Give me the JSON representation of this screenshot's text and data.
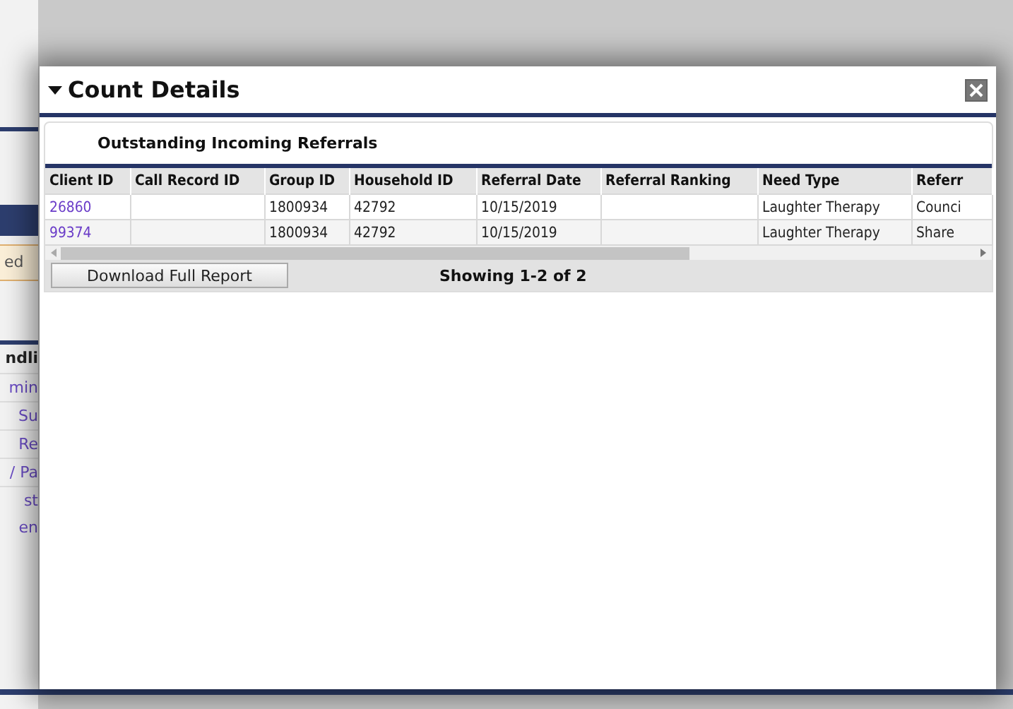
{
  "background": {
    "items": [
      {
        "kind": "note",
        "text": "ed"
      },
      {
        "kind": "heading",
        "text": "ndli"
      },
      {
        "kind": "link",
        "text": "min"
      },
      {
        "kind": "link",
        "text": "Su"
      },
      {
        "kind": "link",
        "text": "Re"
      },
      {
        "kind": "link",
        "text": "/ Pa"
      },
      {
        "kind": "link",
        "text": "st\nen"
      }
    ]
  },
  "dialog": {
    "title": "Count Details",
    "expanded": true,
    "panel": {
      "title": "Outstanding Incoming Referrals",
      "table": {
        "columns": [
          "Client ID",
          "Call Record ID",
          "Group ID",
          "Household ID",
          "Referral Date",
          "Referral Ranking",
          "Need Type",
          "Referr"
        ],
        "rows": [
          [
            "26860",
            "",
            "1800934",
            "42792",
            "10/15/2019",
            "",
            "Laughter Therapy",
            "Counci"
          ],
          [
            "99374",
            "",
            "1800934",
            "42792",
            "10/15/2019",
            "",
            "Laughter Therapy",
            "Share"
          ]
        ]
      },
      "download_button": "Download Full Report",
      "showing": "Showing 1-2 of 2"
    }
  }
}
